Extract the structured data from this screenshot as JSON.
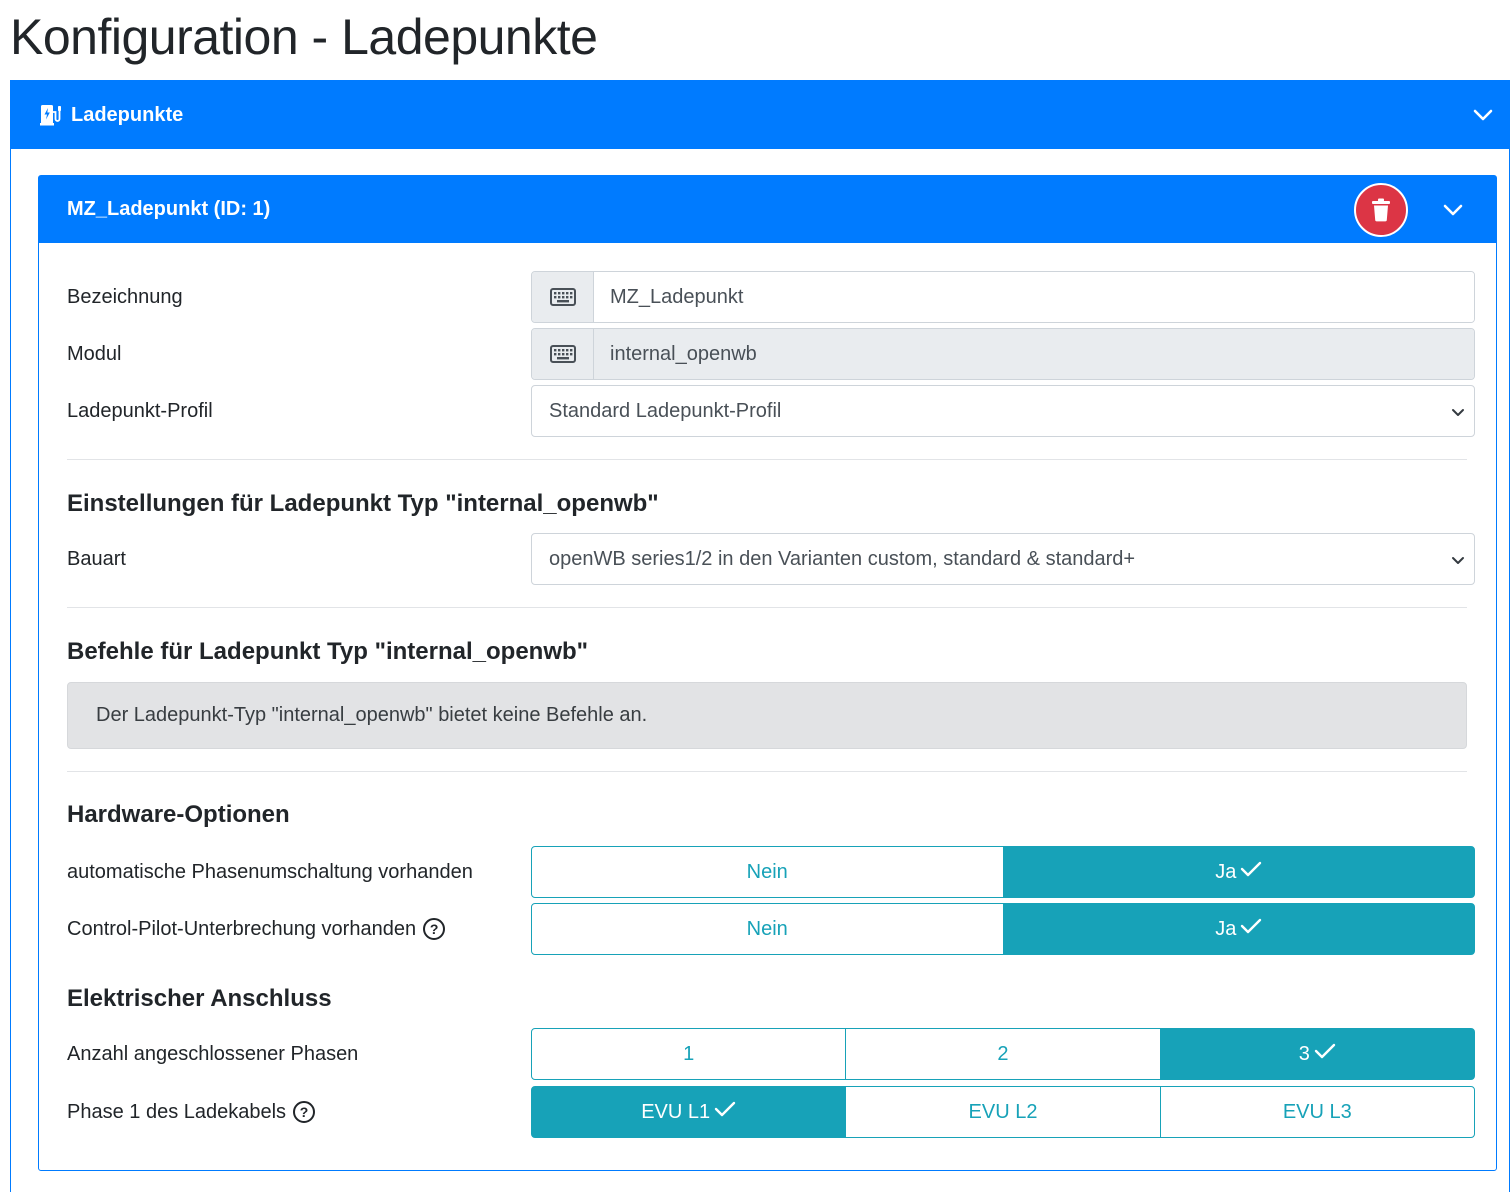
{
  "page": {
    "title": "Konfiguration - Ladepunkte"
  },
  "outer": {
    "title": "Ladepunkte",
    "icon": "charging-station-icon"
  },
  "inner": {
    "title": "MZ_Ladepunkt (ID: 1)"
  },
  "form": {
    "bezeichnung": {
      "label": "Bezeichnung",
      "value": "MZ_Ladepunkt"
    },
    "modul": {
      "label": "Modul",
      "value": "internal_openwb"
    },
    "profil": {
      "label": "Ladepunkt-Profil",
      "value": "Standard Ladepunkt-Profil"
    }
  },
  "einstellungen": {
    "heading": "Einstellungen für Ladepunkt Typ \"internal_openwb\"",
    "bauart": {
      "label": "Bauart",
      "value": "openWB series1/2 in den Varianten custom, standard & standard+"
    }
  },
  "befehle": {
    "heading": "Befehle für Ladepunkt Typ \"internal_openwb\"",
    "info": "Der Ladepunkt-Typ \"internal_openwb\" bietet keine Befehle an."
  },
  "hardware": {
    "heading": "Hardware-Optionen",
    "phasen_umschaltung": {
      "label": "automatische Phasenumschaltung vorhanden",
      "options": [
        "Nein",
        "Ja"
      ],
      "selected": "Ja"
    },
    "cp_unterbrechung": {
      "label": "Control-Pilot-Unterbrechung vorhanden",
      "options": [
        "Nein",
        "Ja"
      ],
      "selected": "Ja"
    }
  },
  "elektrisch": {
    "heading": "Elektrischer Anschluss",
    "anzahl_phasen": {
      "label": "Anzahl angeschlossener Phasen",
      "options": [
        "1",
        "2",
        "3"
      ],
      "selected": "3"
    },
    "phase1": {
      "label": "Phase 1 des Ladekabels",
      "options": [
        "EVU L1",
        "EVU L2",
        "EVU L3"
      ],
      "selected": "EVU L1"
    }
  },
  "help_glyph": "?",
  "colors": {
    "primary": "#007bff",
    "danger": "#dc3545",
    "info": "#17a2b8"
  }
}
